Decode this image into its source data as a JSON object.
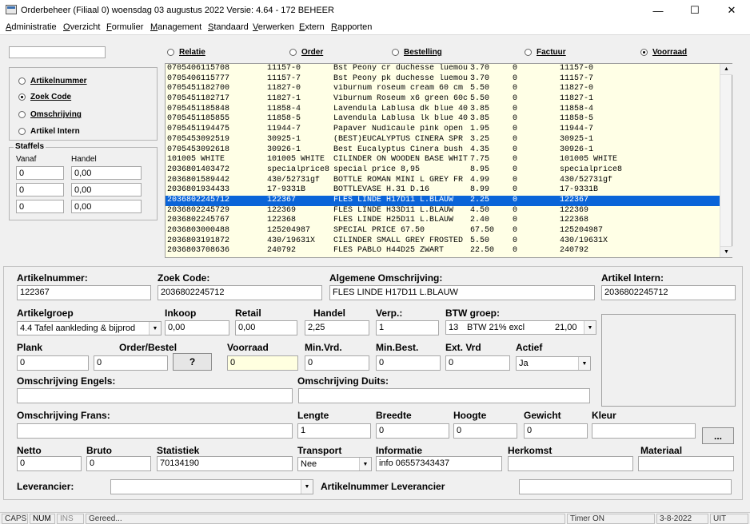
{
  "window": {
    "title": "Orderbeheer (Filiaal 0)  woensdag 03 augustus 2022   Versie: 4.64 - 172  BEHEER",
    "minimize": "—",
    "maximize": "☐",
    "close": "✕"
  },
  "menu": [
    "Administratie",
    "Overzicht",
    "Formulier",
    "Management",
    "Standaard",
    "Verwerken",
    "Extern",
    "Rapporten"
  ],
  "search": {
    "value": ""
  },
  "modes": [
    {
      "label": "Relatie",
      "checked": false
    },
    {
      "label": "Order",
      "checked": false
    },
    {
      "label": "Bestelling",
      "checked": false
    },
    {
      "label": "Factuur",
      "checked": false
    },
    {
      "label": "Voorraad",
      "checked": true
    }
  ],
  "search_by": [
    {
      "label": "Artikelnummer",
      "checked": false
    },
    {
      "label": "Zoek Code",
      "checked": true
    },
    {
      "label": "Omschrijving",
      "checked": false
    },
    {
      "label": "Artikel Intern",
      "checked": false
    }
  ],
  "staffels": {
    "title": "Staffels",
    "col1": "Vanaf",
    "col2": "Handel",
    "rows": [
      [
        "0",
        "0,00"
      ],
      [
        "0",
        "0,00"
      ],
      [
        "0",
        "0,00"
      ]
    ]
  },
  "list": {
    "rows": [
      [
        "0705406115708",
        "11157-0",
        "Bst Peony cr duchesse luemou",
        "3.70",
        "0",
        "11157-0"
      ],
      [
        "0705406115777",
        "11157-7",
        "Bst Peony pk duchesse luemou",
        "3.70",
        "0",
        "11157-7"
      ],
      [
        "0705451182700",
        "11827-0",
        "viburnum roseum cream 60 cm",
        "5.50",
        "0",
        "11827-0"
      ],
      [
        "0705451182717",
        "11827-1",
        "Viburnum Roseum x6 green 60c",
        "5.50",
        "0",
        "11827-1"
      ],
      [
        "0705451185848",
        "11858-4",
        "Lavendula Lablusa dk blue 40",
        "3.85",
        "0",
        "11858-4"
      ],
      [
        "0705451185855",
        "11858-5",
        "Lavendula Lablusa lk blue 40",
        "3.85",
        "0",
        "11858-5"
      ],
      [
        "0705451194475",
        "11944-7",
        "Papaver Nudicaule pink open",
        "1.95",
        "0",
        "11944-7"
      ],
      [
        "0705453092519",
        "30925-1",
        "(BEST)EUCALYPTUS CINERA SPR",
        "3.25",
        "0",
        "30925-1"
      ],
      [
        "0705453092618",
        "30926-1",
        "Best Eucalyptus Cinera bush",
        "4.35",
        "0",
        "30926-1"
      ],
      [
        "101005 WHITE",
        "101005 WHITE",
        "CILINDER ON WOODEN BASE WHIT",
        "7.75",
        "0",
        "101005 WHITE"
      ],
      [
        "2036801403472",
        "specialprice8",
        "special price 8,95",
        "8.95",
        "0",
        "specialprice8"
      ],
      [
        "2036801589442",
        "430/52731gf",
        "BOTTLE ROMAN MINI L GREY FR",
        "4.99",
        "0",
        "430/52731gf"
      ],
      [
        "2036801934433",
        "17-9331B",
        "BOTTLEVASE H.31 D.16",
        "8.99",
        "0",
        "17-9331B"
      ],
      [
        "2036802245712",
        "122367",
        "FLES LINDE H17D11 L.BLAUW",
        "2.25",
        "0",
        "122367"
      ],
      [
        "2036802245729",
        "122369",
        "FLES LINDE H33D11 L.BLAUW",
        "4.50",
        "0",
        "122369"
      ],
      [
        "2036802245767",
        "122368",
        "FLES LINDE H25D11 L.BLAUW",
        "2.40",
        "0",
        "122368"
      ],
      [
        "2036803000488",
        "125204987",
        "SPECIAL PRICE 67.50",
        "67.50",
        "0",
        "125204987"
      ],
      [
        "2036803191872",
        "430/19631X",
        "CILINDER SMALL GREY FROSTED",
        "5.50",
        "0",
        "430/19631X"
      ],
      [
        "2036803708636",
        "240792",
        "FLES PABLO H44D25 ZWART",
        "22.50",
        "0",
        "240792"
      ]
    ],
    "selected_index": 13,
    "colors": {
      "background": "#ffffe6",
      "selected": "#0a64d8"
    }
  },
  "detail": {
    "artikelnummer": {
      "label": "Artikelnummer:",
      "value": "122367"
    },
    "zoekcode": {
      "label": "Zoek Code:",
      "value": "2036802245712"
    },
    "omschrijving": {
      "label": "Algemene Omschrijving:",
      "value": "FLES LINDE H17D11 L.BLAUW"
    },
    "intern": {
      "label": "Artikel Intern:",
      "value": "2036802245712"
    },
    "artikelgroep": {
      "label": "Artikelgroep",
      "value": "4.4 Tafel aankleding & bijprod"
    },
    "inkoop": {
      "label": "Inkoop",
      "value": "0,00"
    },
    "retail": {
      "label": "Retail",
      "value": "0,00"
    },
    "handel": {
      "label": "Handel",
      "value": "2,25"
    },
    "verp": {
      "label": "Verp.:",
      "value": "1"
    },
    "btw": {
      "label": "BTW groep:",
      "code": "13",
      "name": "BTW 21% excl",
      "rate": "21,00"
    },
    "plank": {
      "label": "Plank",
      "value": "0"
    },
    "orderbestel": {
      "label": "Order/Bestel",
      "value": "0",
      "button": "?"
    },
    "voorraad": {
      "label": "Voorraad",
      "value": "0"
    },
    "minvrd": {
      "label": "Min.Vrd.",
      "value": "0"
    },
    "minbest": {
      "label": "Min.Best.",
      "value": "0"
    },
    "extvrd": {
      "label": "Ext. Vrd",
      "value": "0"
    },
    "actief": {
      "label": "Actief",
      "value": "Ja"
    },
    "engels": {
      "label": "Omschrijving Engels:",
      "value": ""
    },
    "duits": {
      "label": "Omschrijving Duits:",
      "value": ""
    },
    "frans": {
      "label": "Omschrijving Frans:",
      "value": ""
    },
    "lengte": {
      "label": "Lengte",
      "value": "1"
    },
    "breedte": {
      "label": "Breedte",
      "value": "0"
    },
    "hoogte": {
      "label": "Hoogte",
      "value": "0"
    },
    "gewicht": {
      "label": "Gewicht",
      "value": "0"
    },
    "kleur": {
      "label": "Kleur",
      "value": "",
      "button": "..."
    },
    "netto": {
      "label": "Netto",
      "value": "0"
    },
    "bruto": {
      "label": "Bruto",
      "value": "0"
    },
    "statistiek": {
      "label": "Statistiek",
      "value": "70134190"
    },
    "transport": {
      "label": "Transport",
      "value": "Nee"
    },
    "informatie": {
      "label": "Informatie",
      "value": "info 06557343437"
    },
    "herkomst": {
      "label": "Herkomst",
      "value": ""
    },
    "materiaal": {
      "label": "Materiaal",
      "value": ""
    },
    "leverancier": {
      "label": "Leverancier:",
      "value": ""
    },
    "artnr_lev": {
      "label": "Artikelnummer Leverancier",
      "value": ""
    }
  },
  "status": {
    "caps": "CAPS",
    "num": "NUM",
    "ins": "INS",
    "message": "Gereed...",
    "timer": "Timer ON",
    "date": "3-8-2022",
    "mode": "UIT"
  }
}
